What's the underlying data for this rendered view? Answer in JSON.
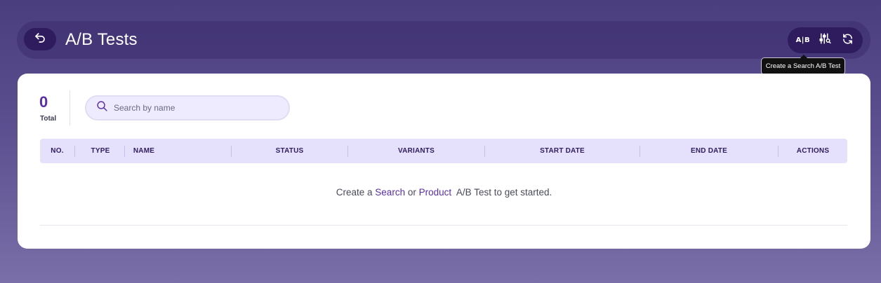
{
  "header": {
    "title": "A/B Tests",
    "back_icon": "back-arrow-icon",
    "toolbar": {
      "ab_label": "A|B",
      "filter_icon": "filter-sliders-icon",
      "refresh_icon": "refresh-icon"
    },
    "tooltip": "Create a Search A/B Test"
  },
  "summary": {
    "total_count": "0",
    "total_label": "Total"
  },
  "search": {
    "placeholder": "Search by name",
    "value": "",
    "icon": "search-icon"
  },
  "table": {
    "columns": [
      "NO.",
      "TYPE",
      "NAME",
      "STATUS",
      "VARIANTS",
      "START DATE",
      "END DATE",
      "ACTIONS"
    ],
    "rows": []
  },
  "empty_state": {
    "prefix": "Create a",
    "search_link": "Search",
    "middle": "or",
    "product_link": "Product",
    "suffix": "A/B Test to get started."
  },
  "colors": {
    "accent": "#5a2ea6",
    "dark_purple": "#2e1c5e",
    "table_header_bg": "#e5e0fb",
    "background_top": "#4a3e7e",
    "background_bottom": "#7a6fa8"
  }
}
